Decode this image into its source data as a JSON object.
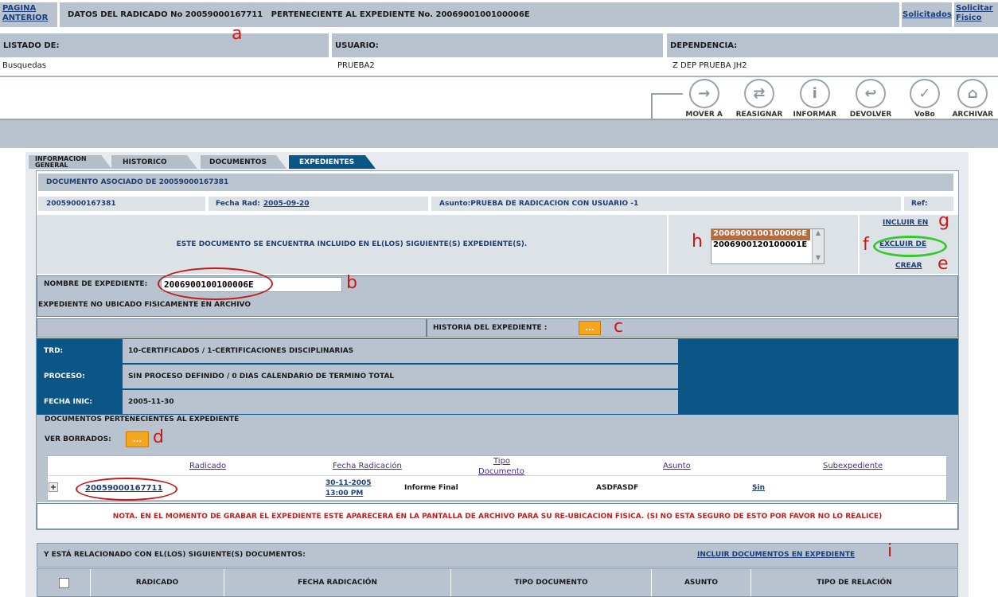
{
  "top_bar": {
    "back_link_line1": "PAGINA",
    "back_link_line2": "ANTERIOR",
    "title": "DATOS DEL RADICADO No 20059000167711   PERTENECIENTE AL EXPEDIENTE No. 2006900100100006E",
    "solicitados_link": "Solicitados",
    "solicitar_line1": "Solicitar",
    "solicitar_line2": "Fisico"
  },
  "info_header": {
    "listado_label": "LISTADO DE:",
    "listado_value": "Busquedas",
    "usuario_label": "USUARIO:",
    "usuario_value": "PRUEBA2",
    "dependencia_label": "DEPENDENCIA:",
    "dependencia_value": "Z DEP PRUEBA JH2"
  },
  "actions": [
    {
      "label": "MOVER A",
      "icon": "arrow-right-icon",
      "glyph": "→"
    },
    {
      "label": "REASIGNAR",
      "icon": "reassign-icon",
      "glyph": "⇄"
    },
    {
      "label": "INFORMAR",
      "icon": "info-icon",
      "glyph": "i"
    },
    {
      "label": "DEVOLVER",
      "icon": "return-icon",
      "glyph": "↩"
    },
    {
      "label": "VoBo",
      "icon": "check-icon",
      "glyph": "✓"
    },
    {
      "label": "ARCHIVAR",
      "icon": "archive-icon",
      "glyph": "⌂"
    }
  ],
  "tabs": {
    "info_line1": "INFORMACION",
    "info_line2": "GENERAL",
    "historico": "HISTORICO",
    "documentos": "DOCUMENTOS",
    "expedientes": "EXPEDIENTES"
  },
  "doc": {
    "header": "DOCUMENTO ASOCIADO DE 20059000167381",
    "radicado": "20059000167381",
    "fecha_rad_label": "Fecha Rad:",
    "fecha_rad_value": "2005-09-20",
    "asunto": "Asunto:PRUEBA DE RADICACION CON USUARIO -1",
    "ref": "Ref:"
  },
  "included": {
    "message": "ESTE DOCUMENTO SE ENCUENTRA INCLUIDO EN EL(LOS) SIGUIENTE(S) EXPEDIENTE(S).",
    "list": [
      "2006900100100006E",
      "2006900120100001E"
    ],
    "incluir_en": "INCLUIR EN",
    "excluir_de": "EXCLUIR DE",
    "crear": "CREAR"
  },
  "expediente": {
    "nombre_label": "NOMBRE DE EXPEDIENTE:",
    "nombre_value": "2006900100100006E",
    "status": "EXPEDIENTE NO UBICADO FISICAMENTE EN ARCHIVO",
    "historia_label": "HISTORIA DEL EXPEDIENTE :",
    "ellipsis": "...",
    "trd_label": "TRD:",
    "trd_value": "10-CERTIFICADOS / 1-CERTIFICACIONES DISCIPLINARIAS",
    "proceso_label": "PROCESO:",
    "proceso_value": "SIN PROCESO DEFINIDO / 0 DIAS CALENDARIO DE TERMINO TOTAL",
    "fecha_label": "FECHA INIC:",
    "fecha_value": "2005-11-30",
    "docs_title": "DOCUMENTOS PERTENECIENTES AL EXPEDIENTE",
    "ver_borrados": "VER BORRADOS:"
  },
  "docs_table": {
    "headers": [
      "Radicado",
      "Fecha Radicación",
      "Tipo",
      "Documento",
      "Asunto",
      "Subexpediente"
    ],
    "row": {
      "expander": "+",
      "radicado": "20059000167711",
      "fecha_line1": "30-11-2005",
      "fecha_line2": "13:00 PM",
      "tipo": "Informe Final",
      "asunto": "ASDFASDF",
      "sub": "Sin"
    }
  },
  "nota": "NOTA. EN EL MOMENTO DE GRABAR EL EXPEDIENTE ESTE APARECERA EN LA PANTALLA DE ARCHIVO PARA SU RE-UBICACION FISICA. (SI NO ESTA SEGURO DE ESTO POR FAVOR NO LO REALICE)",
  "related": {
    "title": "Y ESTÁ RELACIONADO CON EL(LOS) SIGUIENTE(S) DOCUMENTOS:",
    "link": "INCLUIR DOCUMENTOS EN EXPEDIENTE",
    "headers": [
      "RADICADO",
      "FECHA RADICACIÓN",
      "TIPO DOCUMENTO",
      "ASUNTO",
      "TIPO DE RELACIÓN"
    ]
  },
  "annotations": [
    "a",
    "b",
    "c",
    "d",
    "e",
    "f",
    "g",
    "h",
    "i"
  ],
  "colors": {
    "panel_gray": "#b8c3cf",
    "dark_blue": "#0a5a8a",
    "accent_orange": "#f5a51e",
    "nota_red": "#cc1a1a",
    "annotation_red": "#d21414",
    "highlight_green": "#35c92b"
  }
}
